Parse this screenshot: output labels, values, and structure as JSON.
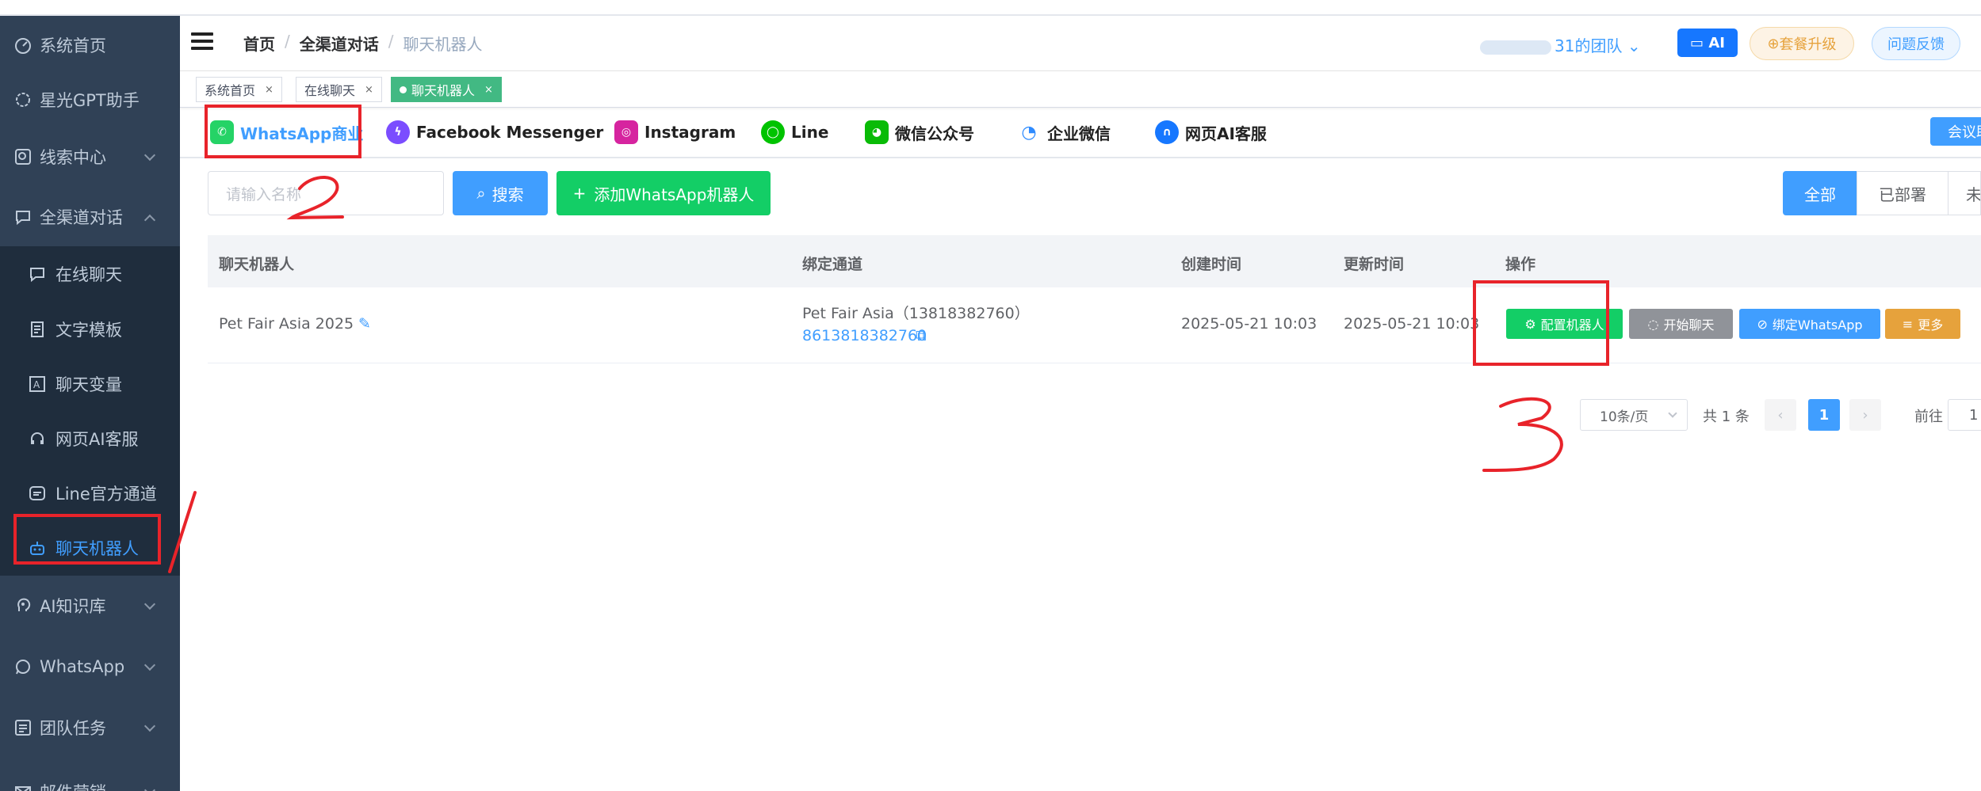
{
  "sidebar": {
    "items": [
      {
        "label": "系统首页",
        "icon": "dashboard-icon"
      },
      {
        "label": "星光GPT助手",
        "icon": "gpt-icon"
      },
      {
        "label": "线索中心",
        "icon": "leads-icon"
      },
      {
        "label": "全渠道对话",
        "icon": "chat-icon"
      },
      {
        "label": "在线聊天",
        "icon": "chat-icon"
      },
      {
        "label": "文字模板",
        "icon": "document-icon"
      },
      {
        "label": "聊天变量",
        "icon": "variable-icon"
      },
      {
        "label": "网页AI客服",
        "icon": "headset-icon"
      },
      {
        "label": "Line官方通道",
        "icon": "line-icon"
      },
      {
        "label": "聊天机器人",
        "icon": "robot-icon"
      },
      {
        "label": "AI知识库",
        "icon": "brain-icon"
      },
      {
        "label": "WhatsApp",
        "icon": "whatsapp-icon"
      },
      {
        "label": "团队任务",
        "icon": "task-icon"
      },
      {
        "label": "邮件营销",
        "icon": "mail-icon"
      }
    ]
  },
  "header": {
    "breadcrumb": [
      "首页",
      "全渠道对话",
      "聊天机器人"
    ],
    "team_label": "31的团队",
    "ai_label": "AI",
    "upgrade_label": "套餐升级",
    "feedback_label": "问题反馈"
  },
  "tags": [
    {
      "label": "系统首页",
      "active": false
    },
    {
      "label": "在线聊天",
      "active": false
    },
    {
      "label": "聊天机器人",
      "active": true
    }
  ],
  "channels": [
    {
      "label": "WhatsApp商业",
      "icon": "whatsapp-icon",
      "active": true,
      "color": "#25d366"
    },
    {
      "label": "Facebook Messenger",
      "icon": "messenger-icon",
      "active": false,
      "color": "#7b4dff"
    },
    {
      "label": "Instagram",
      "icon": "instagram-icon",
      "active": false,
      "color": "#d6249f"
    },
    {
      "label": "Line",
      "icon": "line-icon",
      "active": false,
      "color": "#00c300"
    },
    {
      "label": "微信公众号",
      "icon": "wechat-icon",
      "active": false,
      "color": "#09bb07"
    },
    {
      "label": "企业微信",
      "icon": "wecom-icon",
      "active": false,
      "color": "#2e8bff"
    },
    {
      "label": "网页AI客服",
      "icon": "headset-icon",
      "active": false,
      "color": "#1677ff"
    }
  ],
  "meeting_label": "会议助",
  "toolbar": {
    "search_placeholder": "请输入名称",
    "search_label": "搜索",
    "add_label": "添加WhatsApp机器人"
  },
  "filters": [
    "全部",
    "已部署",
    "未"
  ],
  "table": {
    "headers": [
      "聊天机器人",
      "绑定通道",
      "创建时间",
      "更新时间",
      "操作"
    ],
    "rows": [
      {
        "name": "Pet Fair Asia 2025",
        "channel_name": "Pet Fair Asia（13818382760）",
        "channel_number": "8613818382760",
        "created": "2025-05-21 10:03",
        "updated": "2025-05-21 10:03",
        "actions": [
          "配置机器人",
          "开始聊天",
          "绑定WhatsApp",
          "更多"
        ]
      }
    ]
  },
  "pagination": {
    "page_size": "10条/页",
    "total": "共 1 条",
    "current": "1",
    "goto_label": "前往",
    "goto_value": "1"
  },
  "annotations": [
    "1",
    "2",
    "3"
  ],
  "colors": {
    "sidebar_bg": "#304156",
    "primary": "#409eff",
    "success": "#13ce66",
    "warning": "#e6a23c",
    "annotation_red": "#e8232a"
  }
}
